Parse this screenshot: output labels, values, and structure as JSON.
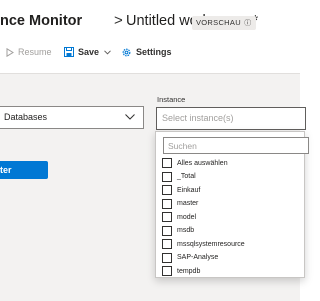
{
  "header": {
    "app_title": "nce Monitor",
    "separator": ">",
    "workspace": "Untitled workspace *",
    "preview_badge": "VORSCHAU"
  },
  "toolbar": {
    "resume_label": "Resume",
    "save_label": "Save",
    "settings_label": "Settings"
  },
  "filters": {
    "database_value": "Databases",
    "instance_label": "Instance",
    "instance_placeholder": "Select instance(s)"
  },
  "action_button_label": "ter",
  "instance_popup": {
    "search_placeholder": "Suchen",
    "options": [
      "Alles auswählen",
      "_Total",
      "Einkauf",
      "master",
      "model",
      "msdb",
      "mssqlsystemresource",
      "SAP-Analyse",
      "tempdb"
    ]
  },
  "colors": {
    "accent": "#0078d4",
    "panel_bg": "#f3f2f1"
  },
  "icons": {
    "resume": "play-icon",
    "save": "save-icon",
    "settings": "gear-icon",
    "dropdown": "chevron-down-icon",
    "info": "info-icon"
  }
}
